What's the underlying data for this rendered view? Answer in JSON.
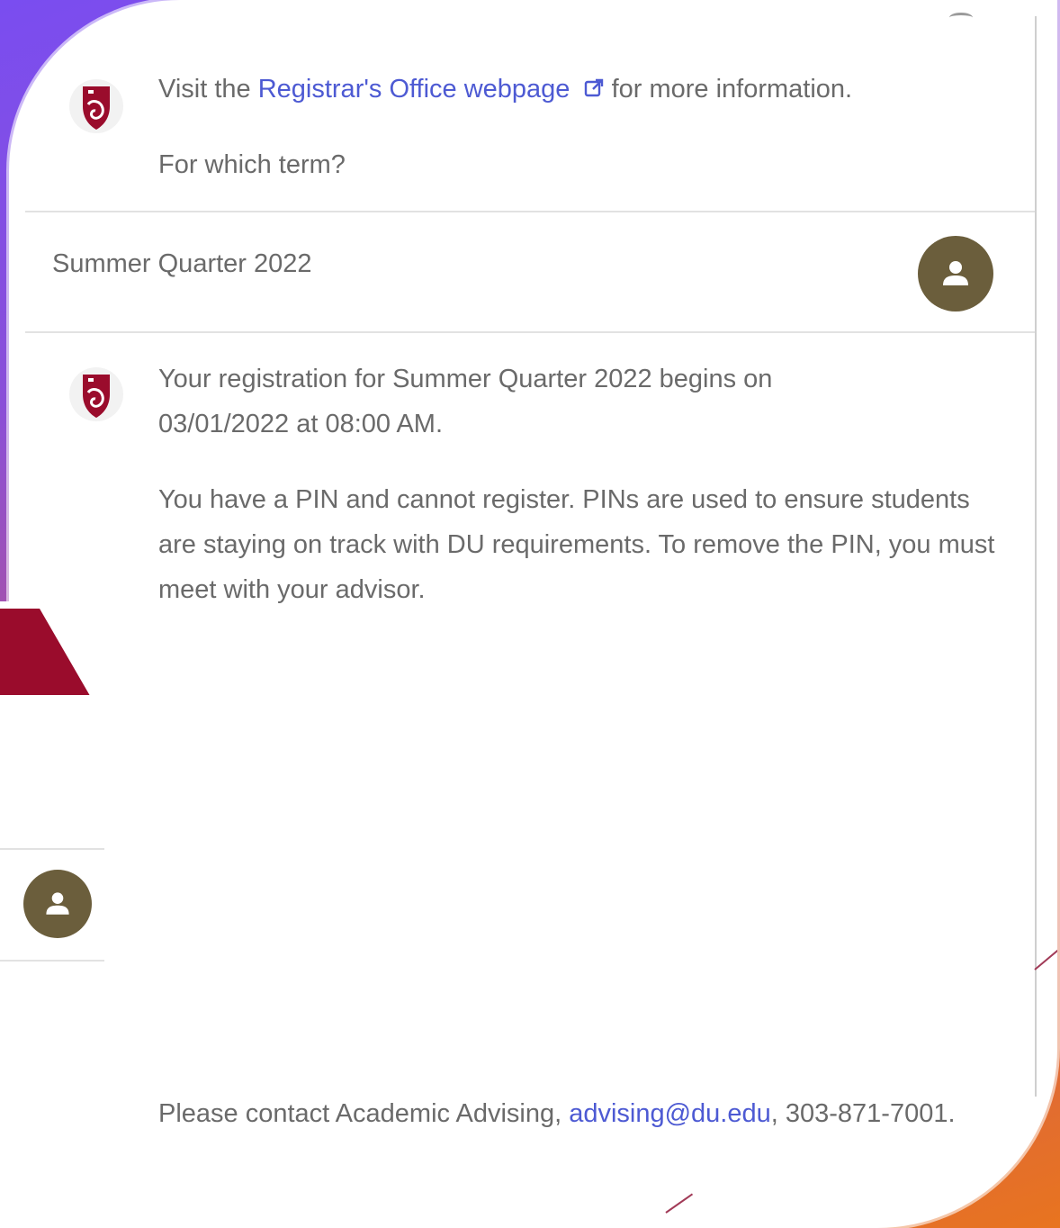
{
  "colors": {
    "bot_crest": "#9a0c2c",
    "user_avatar": "#6b5e3c",
    "link": "#4d5ad3",
    "text": "#6a6a6a",
    "side_header": "#9a0c2c"
  },
  "conversation": {
    "msg1": {
      "prefix": "Visit the ",
      "link_text": "Registrar's Office webpage",
      "link_icon": "external-link-icon",
      "suffix": " for more information."
    },
    "msg1_followup": "For which term?",
    "user_reply": "Summer Quarter 2022",
    "msg2": {
      "paragraph1": "Your registration for Summer Quarter 2022 begins on 03/01/2022 at 08:00 AM.",
      "paragraph2": "You have a PIN and cannot register. PINs are used to ensure students are staying on track with DU requirements. To remove the PIN, you must meet with your advisor."
    },
    "msg3": {
      "prefix": "Please contact Academic Advising, ",
      "link_text": "advising@du.edu",
      "suffix": ", 303-871-7001."
    }
  },
  "icons": {
    "bot": "university-crest-icon",
    "user": "user-icon"
  }
}
